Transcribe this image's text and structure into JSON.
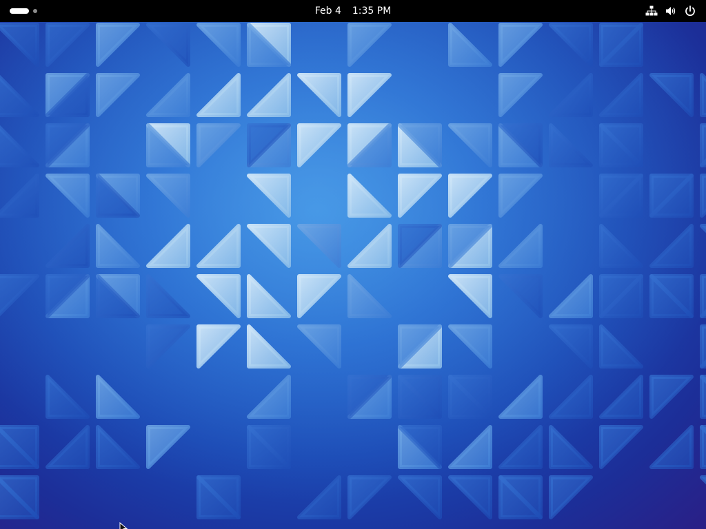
{
  "topbar": {
    "date": "Feb 4",
    "time": "1:35 PM",
    "background_color": "#000000",
    "text_color": "#ffffff"
  },
  "status_icons": [
    "network-wired-icon",
    "volume-icon",
    "power-icon"
  ],
  "wallpaper": {
    "style": "blue geometric triangles",
    "colors": [
      "#1c2e98",
      "#2264cc",
      "#3a8ee0",
      "#a9d2f0"
    ]
  }
}
